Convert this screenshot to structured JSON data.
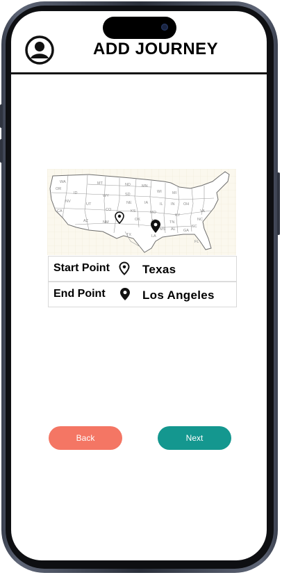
{
  "header": {
    "title": "ADD JOURNEY",
    "avatar_icon": "user-circle-icon"
  },
  "map": {
    "state_labels": [
      "WA",
      "MT",
      "ND",
      "MN",
      "OR",
      "ID",
      "WY",
      "SD",
      "WI",
      "MI",
      "NV",
      "UT",
      "NE",
      "IA",
      "IL",
      "IN",
      "OH",
      "CA",
      "CO",
      "KS",
      "MO",
      "KY",
      "VA",
      "AZ",
      "NM",
      "OK",
      "AR",
      "TN",
      "NC",
      "SC",
      "MS",
      "AL",
      "GA",
      "LA",
      "TX",
      "FL"
    ],
    "marker_icon": "map-pin-icon"
  },
  "journey": {
    "start_label": "Start Point",
    "start_value": "Texas",
    "start_icon": "map-pin-outline-icon",
    "end_label": "End Point",
    "end_value": "Los Angeles",
    "end_icon": "map-pin-solid-icon"
  },
  "buttons": {
    "back_label": "Back",
    "next_label": "Next"
  },
  "colors": {
    "back": "#f47664",
    "next": "#14978f",
    "map_bg": "#fbf8ee"
  }
}
